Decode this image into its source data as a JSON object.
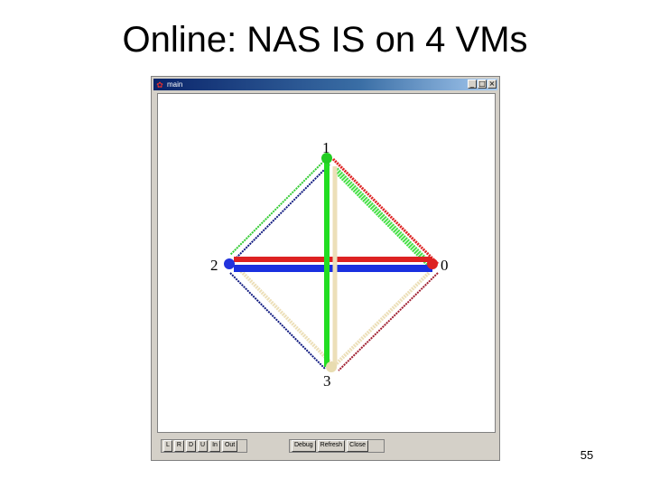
{
  "slide": {
    "title": "Online: NAS IS on 4 VMs",
    "page_number": "55"
  },
  "window": {
    "title": "main",
    "icon": "app-icon",
    "controls": [
      "_",
      "□",
      "×"
    ]
  },
  "graph": {
    "nodes": [
      {
        "id": "1",
        "color": "#22cc22"
      },
      {
        "id": "0",
        "color": "#dd2222"
      },
      {
        "id": "2",
        "color": "#2233dd"
      },
      {
        "id": "3",
        "color": "#e8dcb0"
      }
    ],
    "edge_colors": {
      "red": "#dd2222",
      "blue": "#1a30e0",
      "green": "#22dd22",
      "beige": "#ecdfb8",
      "darkred": "#a02030",
      "navy": "#101a80"
    }
  },
  "toolbar": {
    "left_buttons": [
      "L",
      "R",
      "D",
      "U",
      "In",
      "Out"
    ],
    "right_buttons": [
      "Debug",
      "Refresh",
      "Close"
    ]
  }
}
